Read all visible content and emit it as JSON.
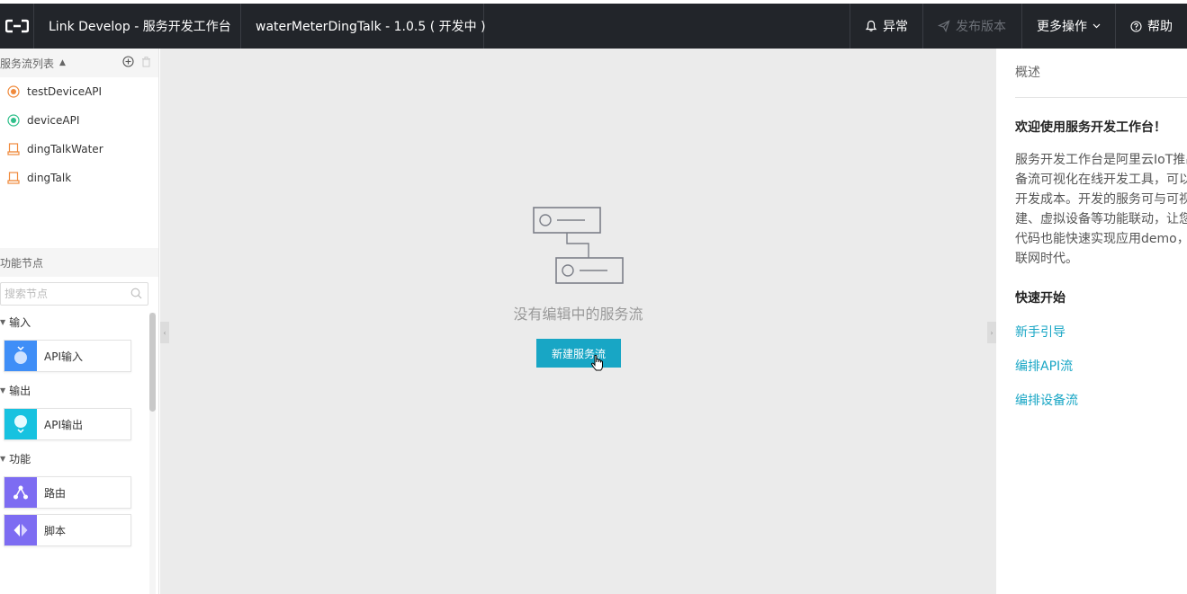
{
  "topbar": {
    "title": "Link Develop - 服务开发工作台",
    "project": "waterMeterDingTalk - 1.0.5 ( 开发中 )",
    "buttons": {
      "exception": "异常",
      "publish": "发布版本",
      "more": "更多操作",
      "help": "帮助"
    }
  },
  "sidebar": {
    "flow_list_title": "服务流列表",
    "flows": [
      {
        "label": "testDeviceAPI",
        "icon": "api-flow-icon",
        "color": "#f08a3c"
      },
      {
        "label": "deviceAPI",
        "icon": "api-flow-icon",
        "color": "#2fbf8a"
      },
      {
        "label": "dingTalkWater",
        "icon": "device-flow-icon",
        "color": "#f08a3c"
      },
      {
        "label": "dingTalk",
        "icon": "device-flow-icon",
        "color": "#f08a3c"
      }
    ],
    "nodes_title": "功能节点",
    "search": {
      "placeholder": "搜索节点",
      "value": ""
    },
    "groups": [
      {
        "label": "输入",
        "nodes": [
          {
            "label": "API输入",
            "icon": "api-input-icon",
            "color": "#3f8ef7"
          }
        ]
      },
      {
        "label": "输出",
        "nodes": [
          {
            "label": "API输出",
            "icon": "api-output-icon",
            "color": "#17c2e0"
          }
        ]
      },
      {
        "label": "功能",
        "nodes": [
          {
            "label": "路由",
            "icon": "router-icon",
            "color": "#7d6cf2"
          },
          {
            "label": "脚本",
            "icon": "script-icon",
            "color": "#7d6cf2"
          }
        ]
      }
    ]
  },
  "canvas": {
    "empty_text": "没有编辑中的服务流",
    "new_button": "新建服务流"
  },
  "right_panel": {
    "tab": "概述",
    "welcome_title": "欢迎使用服务开发工作台！",
    "intro_lines": [
      "服务开发工作台是阿里云IoT推出",
      "备流可视化在线开发工具，可以",
      "开发成本。开发的服务可与可视",
      "建、虚拟设备等功能联动，让您",
      "代码也能快速实现应用demo，助",
      "联网时代。"
    ],
    "quick_start_title": "快速开始",
    "links": [
      "新手引导",
      "编排API流",
      "编排设备流"
    ]
  },
  "colors": {
    "topbar_bg": "#22252a",
    "accent": "#18a6c5",
    "canvas_bg": "#ebebeb"
  }
}
